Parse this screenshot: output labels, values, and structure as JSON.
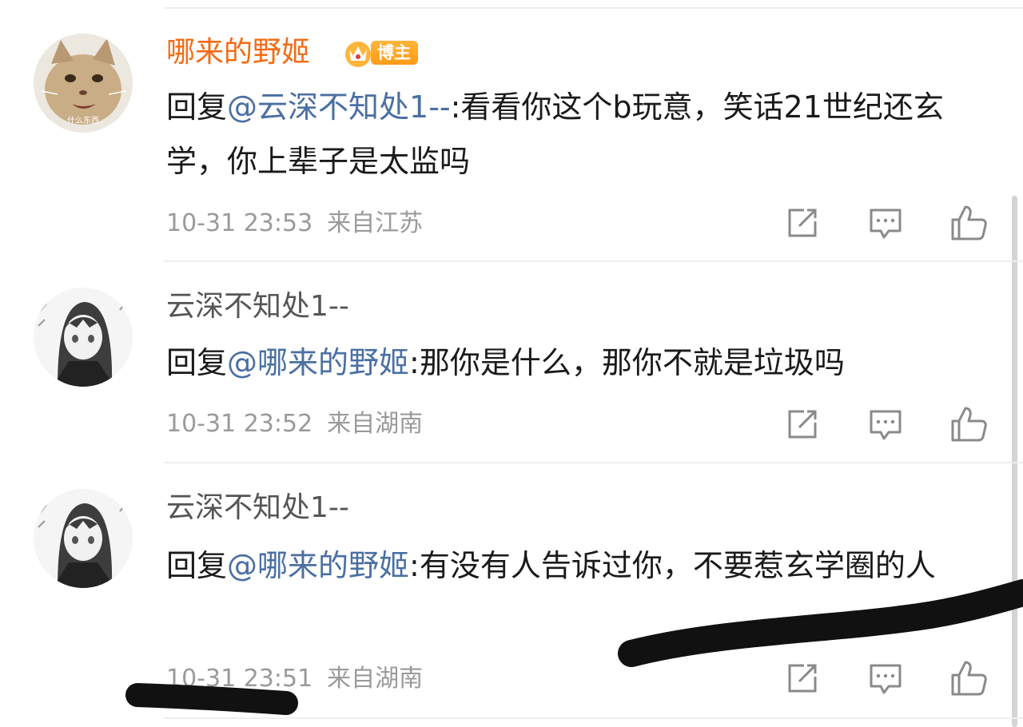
{
  "comments": [
    {
      "username": "哪来的野姬",
      "badge": "博主",
      "reply_prefix": "回复",
      "mention": "@云深不知处1--",
      "text": ":看看你这个b玩意，笑话21世纪还玄学，你上辈子是太监吗",
      "time": "10-31 23:53",
      "location": "来自江苏",
      "avatar_caption": "什么东西",
      "icons": [
        "share-icon",
        "comment-icon",
        "like-icon"
      ]
    },
    {
      "username": "云深不知处1--",
      "reply_prefix": "回复",
      "mention": "@哪来的野姬",
      "text": ":那你是什么，那你不就是垃圾吗",
      "time": "10-31 23:52",
      "location": "来自湖南",
      "icons": [
        "share-icon",
        "comment-icon",
        "like-icon"
      ]
    },
    {
      "username": "云深不知处1--",
      "reply_prefix": "回复",
      "mention": "@哪来的野姬",
      "text": ":有没有人告诉过你，不要惹玄学圈的人",
      "time": "10-31 23:51",
      "location": "来自湖南",
      "icons": [
        "share-icon",
        "comment-icon",
        "like-icon"
      ]
    }
  ],
  "colors": {
    "vip_name": "#f36a12",
    "normal_name": "#555555",
    "mention": "#4a6fa3",
    "meta": "#9a9a9a",
    "badge": "#ff9a18",
    "scribble": "#111111"
  }
}
